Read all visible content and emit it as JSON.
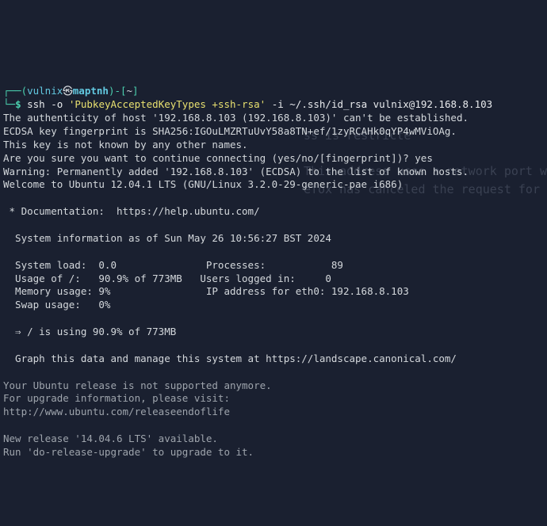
{
  "ghost": {
    "l1": "ss is restricte",
    "l2": "This address uses a network port w",
    "l3": "efox has canceled the request for"
  },
  "prompt": {
    "open_top": "┌──(",
    "user": "vulnix",
    "at": "㉿",
    "host": "maptnh",
    "close1": ")-[",
    "cwd": "~",
    "close2": "]",
    "open_bot": "└─",
    "dollar": "$"
  },
  "cmd": {
    "bin": "ssh",
    "flag_o": " -o ",
    "optval": "'PubkeyAcceptedKeyTypes +ssh-rsa'",
    "flag_i": " -i ",
    "keypath": "~/.ssh/id_rsa",
    "target": " vulnix@192.168.8.103"
  },
  "out": {
    "l1": "The authenticity of host '192.168.8.103 (192.168.8.103)' can't be established.",
    "l2": "ECDSA key fingerprint is SHA256:IGOuLMZRTuUvY58a8TN+ef/1zyRCAHk0qYP4wMViOAg.",
    "l3": "This key is not known by any other names.",
    "l4a": "Are you sure you want to continue connecting (yes/no/[fingerprint])? ",
    "l4b": "yes",
    "l5": "Warning: Permanently added '192.168.8.103' (ECDSA) to the list of known hosts.",
    "l6": "Welcome to Ubuntu 12.04.1 LTS (GNU/Linux 3.2.0-29-generic-pae i686)",
    "blank": " ",
    "doc_star": " * ",
    "doc": "Documentation:  https://help.ubuntu.com/",
    "sysinfo": "  System information as of Sun May 26 10:56:27 BST 2024",
    "row1": "  System load:  0.0               Processes:           89",
    "row2": "  Usage of /:   90.9% of 773MB   Users logged in:     0",
    "row3": "  Memory usage: 9%                IP address for eth0: 192.168.8.103",
    "row4": "  Swap usage:   0%",
    "arrow": "  ⇒ ",
    "arrow_txt": "/ is using 90.9% of 773MB",
    "graph": "  Graph this data and manage this system at https://landscape.canonical.com/",
    "unsup1": "Your Ubuntu release is not supported anymore.",
    "unsup2": "For upgrade information, please visit:",
    "unsup3": "http://www.ubuntu.com/releaseendoflife",
    "newrel1": "New release '14.04.6 LTS' available.",
    "newrel2": "Run 'do-release-upgrade' to upgrade to it."
  }
}
